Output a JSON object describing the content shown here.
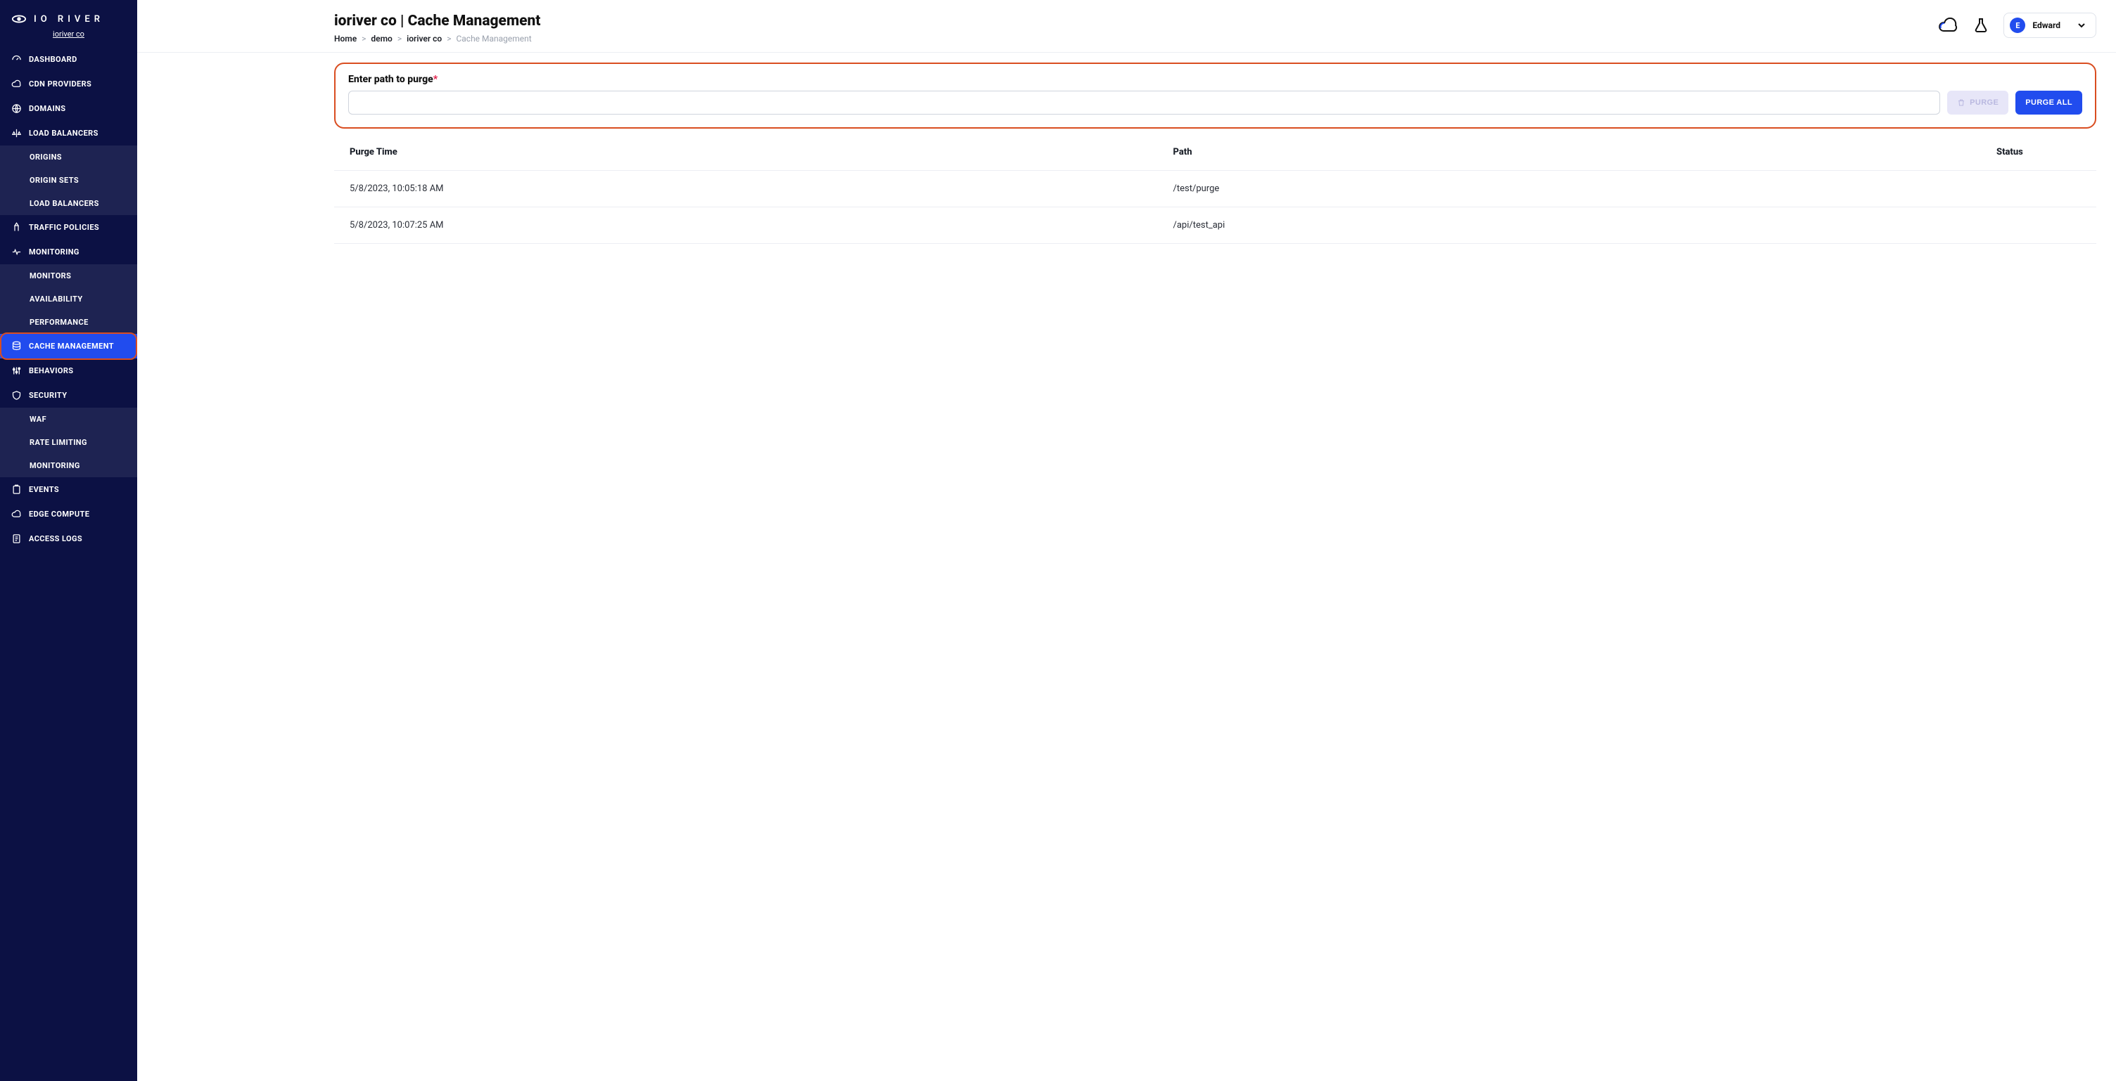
{
  "brand": {
    "name": "IO RIVER",
    "subtitle": "ioriver co"
  },
  "sidebar": {
    "items": [
      {
        "label": "DASHBOARD"
      },
      {
        "label": "CDN PROVIDERS"
      },
      {
        "label": "DOMAINS"
      },
      {
        "label": "LOAD BALANCERS"
      },
      {
        "label": "TRAFFIC POLICIES"
      },
      {
        "label": "MONITORING"
      },
      {
        "label": "CACHE MANAGEMENT"
      },
      {
        "label": "BEHAVIORS"
      },
      {
        "label": "SECURITY"
      },
      {
        "label": "EVENTS"
      },
      {
        "label": "EDGE COMPUTE"
      },
      {
        "label": "ACCESS LOGS"
      }
    ],
    "sub_lb": [
      {
        "label": "ORIGINS"
      },
      {
        "label": "ORIGIN SETS"
      },
      {
        "label": "LOAD BALANCERS"
      }
    ],
    "sub_mon": [
      {
        "label": "MONITORS"
      },
      {
        "label": "AVAILABILITY"
      },
      {
        "label": "PERFORMANCE"
      }
    ],
    "sub_sec": [
      {
        "label": "WAF"
      },
      {
        "label": "RATE LIMITING"
      },
      {
        "label": "MONITORING"
      }
    ]
  },
  "header": {
    "title": "ioriver co | Cache Management",
    "breadcrumbs": [
      {
        "label": "Home"
      },
      {
        "label": "demo"
      },
      {
        "label": "ioriver co"
      },
      {
        "label": "Cache Management"
      }
    ],
    "sep": ">"
  },
  "user": {
    "initial": "E",
    "name": "Edward"
  },
  "purge": {
    "label": "Enter path to purge",
    "required_marker": "*",
    "value": "",
    "purge_btn": "PURGE",
    "purge_all_btn": "PURGE ALL"
  },
  "table": {
    "columns": {
      "c0": "Purge Time",
      "c1": "Path",
      "c2": "Status"
    },
    "rows": [
      {
        "time": "5/8/2023, 10:05:18 AM",
        "path": "/test/purge",
        "status": ""
      },
      {
        "time": "5/8/2023, 10:07:25 AM",
        "path": "/api/test_api",
        "status": ""
      }
    ]
  }
}
